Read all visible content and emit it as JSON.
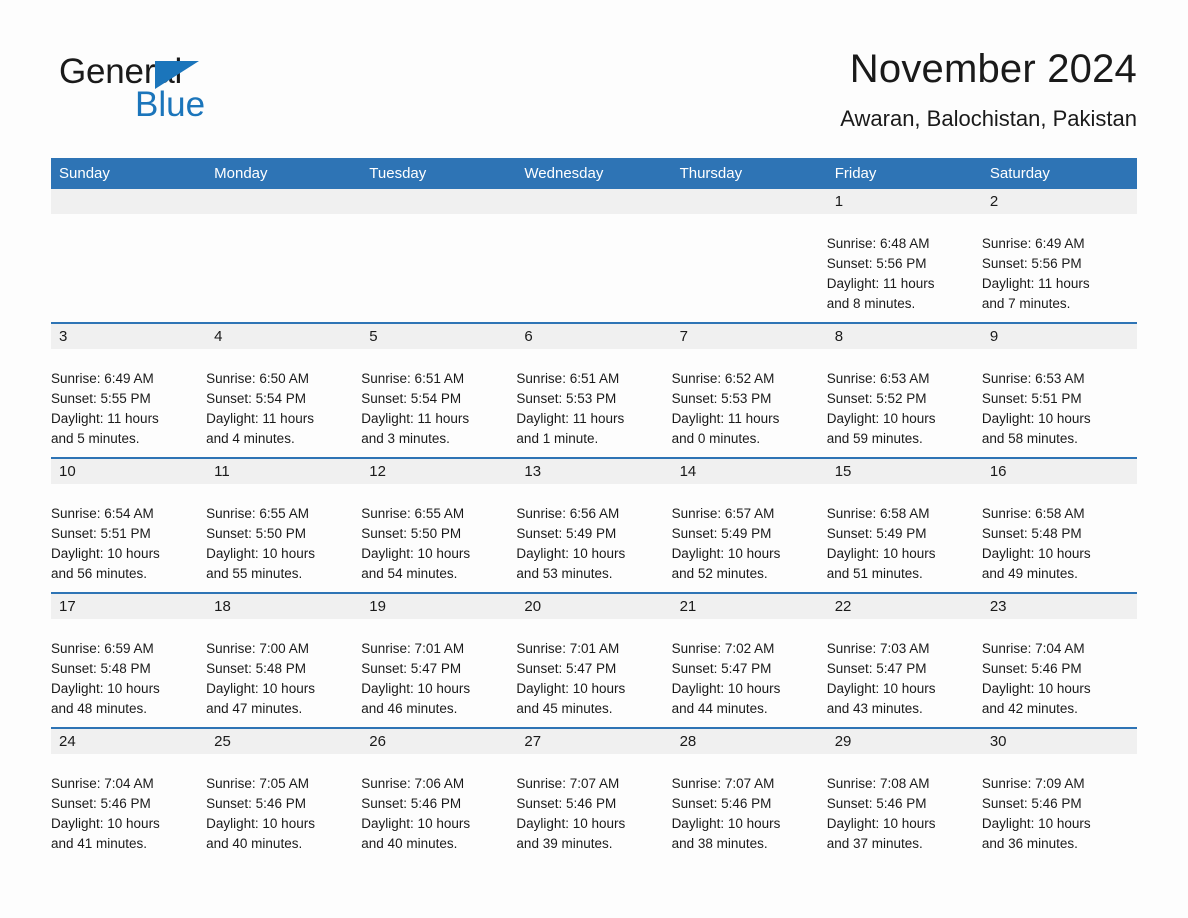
{
  "brand": {
    "name_part1": "General",
    "name_part2": "Blue",
    "triangle_color": "#1b75bb"
  },
  "header": {
    "title": "November 2024",
    "subtitle": "Awaran, Balochistan, Pakistan"
  },
  "theme": {
    "header_blue": "#2e74b5",
    "daynum_band": "#f0f0f0",
    "page_background": "#fdfdfd",
    "text_color": "#1a1a1a"
  },
  "weekday_headers": [
    "Sunday",
    "Monday",
    "Tuesday",
    "Wednesday",
    "Thursday",
    "Friday",
    "Saturday"
  ],
  "weeks": [
    [
      {
        "day": "",
        "sunrise": "",
        "sunset": "",
        "daylight1": "",
        "daylight2": ""
      },
      {
        "day": "",
        "sunrise": "",
        "sunset": "",
        "daylight1": "",
        "daylight2": ""
      },
      {
        "day": "",
        "sunrise": "",
        "sunset": "",
        "daylight1": "",
        "daylight2": ""
      },
      {
        "day": "",
        "sunrise": "",
        "sunset": "",
        "daylight1": "",
        "daylight2": ""
      },
      {
        "day": "",
        "sunrise": "",
        "sunset": "",
        "daylight1": "",
        "daylight2": ""
      },
      {
        "day": "1",
        "sunrise": "Sunrise: 6:48 AM",
        "sunset": "Sunset: 5:56 PM",
        "daylight1": "Daylight: 11 hours",
        "daylight2": "and 8 minutes."
      },
      {
        "day": "2",
        "sunrise": "Sunrise: 6:49 AM",
        "sunset": "Sunset: 5:56 PM",
        "daylight1": "Daylight: 11 hours",
        "daylight2": "and 7 minutes."
      }
    ],
    [
      {
        "day": "3",
        "sunrise": "Sunrise: 6:49 AM",
        "sunset": "Sunset: 5:55 PM",
        "daylight1": "Daylight: 11 hours",
        "daylight2": "and 5 minutes."
      },
      {
        "day": "4",
        "sunrise": "Sunrise: 6:50 AM",
        "sunset": "Sunset: 5:54 PM",
        "daylight1": "Daylight: 11 hours",
        "daylight2": "and 4 minutes."
      },
      {
        "day": "5",
        "sunrise": "Sunrise: 6:51 AM",
        "sunset": "Sunset: 5:54 PM",
        "daylight1": "Daylight: 11 hours",
        "daylight2": "and 3 minutes."
      },
      {
        "day": "6",
        "sunrise": "Sunrise: 6:51 AM",
        "sunset": "Sunset: 5:53 PM",
        "daylight1": "Daylight: 11 hours",
        "daylight2": "and 1 minute."
      },
      {
        "day": "7",
        "sunrise": "Sunrise: 6:52 AM",
        "sunset": "Sunset: 5:53 PM",
        "daylight1": "Daylight: 11 hours",
        "daylight2": "and 0 minutes."
      },
      {
        "day": "8",
        "sunrise": "Sunrise: 6:53 AM",
        "sunset": "Sunset: 5:52 PM",
        "daylight1": "Daylight: 10 hours",
        "daylight2": "and 59 minutes."
      },
      {
        "day": "9",
        "sunrise": "Sunrise: 6:53 AM",
        "sunset": "Sunset: 5:51 PM",
        "daylight1": "Daylight: 10 hours",
        "daylight2": "and 58 minutes."
      }
    ],
    [
      {
        "day": "10",
        "sunrise": "Sunrise: 6:54 AM",
        "sunset": "Sunset: 5:51 PM",
        "daylight1": "Daylight: 10 hours",
        "daylight2": "and 56 minutes."
      },
      {
        "day": "11",
        "sunrise": "Sunrise: 6:55 AM",
        "sunset": "Sunset: 5:50 PM",
        "daylight1": "Daylight: 10 hours",
        "daylight2": "and 55 minutes."
      },
      {
        "day": "12",
        "sunrise": "Sunrise: 6:55 AM",
        "sunset": "Sunset: 5:50 PM",
        "daylight1": "Daylight: 10 hours",
        "daylight2": "and 54 minutes."
      },
      {
        "day": "13",
        "sunrise": "Sunrise: 6:56 AM",
        "sunset": "Sunset: 5:49 PM",
        "daylight1": "Daylight: 10 hours",
        "daylight2": "and 53 minutes."
      },
      {
        "day": "14",
        "sunrise": "Sunrise: 6:57 AM",
        "sunset": "Sunset: 5:49 PM",
        "daylight1": "Daylight: 10 hours",
        "daylight2": "and 52 minutes."
      },
      {
        "day": "15",
        "sunrise": "Sunrise: 6:58 AM",
        "sunset": "Sunset: 5:49 PM",
        "daylight1": "Daylight: 10 hours",
        "daylight2": "and 51 minutes."
      },
      {
        "day": "16",
        "sunrise": "Sunrise: 6:58 AM",
        "sunset": "Sunset: 5:48 PM",
        "daylight1": "Daylight: 10 hours",
        "daylight2": "and 49 minutes."
      }
    ],
    [
      {
        "day": "17",
        "sunrise": "Sunrise: 6:59 AM",
        "sunset": "Sunset: 5:48 PM",
        "daylight1": "Daylight: 10 hours",
        "daylight2": "and 48 minutes."
      },
      {
        "day": "18",
        "sunrise": "Sunrise: 7:00 AM",
        "sunset": "Sunset: 5:48 PM",
        "daylight1": "Daylight: 10 hours",
        "daylight2": "and 47 minutes."
      },
      {
        "day": "19",
        "sunrise": "Sunrise: 7:01 AM",
        "sunset": "Sunset: 5:47 PM",
        "daylight1": "Daylight: 10 hours",
        "daylight2": "and 46 minutes."
      },
      {
        "day": "20",
        "sunrise": "Sunrise: 7:01 AM",
        "sunset": "Sunset: 5:47 PM",
        "daylight1": "Daylight: 10 hours",
        "daylight2": "and 45 minutes."
      },
      {
        "day": "21",
        "sunrise": "Sunrise: 7:02 AM",
        "sunset": "Sunset: 5:47 PM",
        "daylight1": "Daylight: 10 hours",
        "daylight2": "and 44 minutes."
      },
      {
        "day": "22",
        "sunrise": "Sunrise: 7:03 AM",
        "sunset": "Sunset: 5:47 PM",
        "daylight1": "Daylight: 10 hours",
        "daylight2": "and 43 minutes."
      },
      {
        "day": "23",
        "sunrise": "Sunrise: 7:04 AM",
        "sunset": "Sunset: 5:46 PM",
        "daylight1": "Daylight: 10 hours",
        "daylight2": "and 42 minutes."
      }
    ],
    [
      {
        "day": "24",
        "sunrise": "Sunrise: 7:04 AM",
        "sunset": "Sunset: 5:46 PM",
        "daylight1": "Daylight: 10 hours",
        "daylight2": "and 41 minutes."
      },
      {
        "day": "25",
        "sunrise": "Sunrise: 7:05 AM",
        "sunset": "Sunset: 5:46 PM",
        "daylight1": "Daylight: 10 hours",
        "daylight2": "and 40 minutes."
      },
      {
        "day": "26",
        "sunrise": "Sunrise: 7:06 AM",
        "sunset": "Sunset: 5:46 PM",
        "daylight1": "Daylight: 10 hours",
        "daylight2": "and 40 minutes."
      },
      {
        "day": "27",
        "sunrise": "Sunrise: 7:07 AM",
        "sunset": "Sunset: 5:46 PM",
        "daylight1": "Daylight: 10 hours",
        "daylight2": "and 39 minutes."
      },
      {
        "day": "28",
        "sunrise": "Sunrise: 7:07 AM",
        "sunset": "Sunset: 5:46 PM",
        "daylight1": "Daylight: 10 hours",
        "daylight2": "and 38 minutes."
      },
      {
        "day": "29",
        "sunrise": "Sunrise: 7:08 AM",
        "sunset": "Sunset: 5:46 PM",
        "daylight1": "Daylight: 10 hours",
        "daylight2": "and 37 minutes."
      },
      {
        "day": "30",
        "sunrise": "Sunrise: 7:09 AM",
        "sunset": "Sunset: 5:46 PM",
        "daylight1": "Daylight: 10 hours",
        "daylight2": "and 36 minutes."
      }
    ]
  ]
}
